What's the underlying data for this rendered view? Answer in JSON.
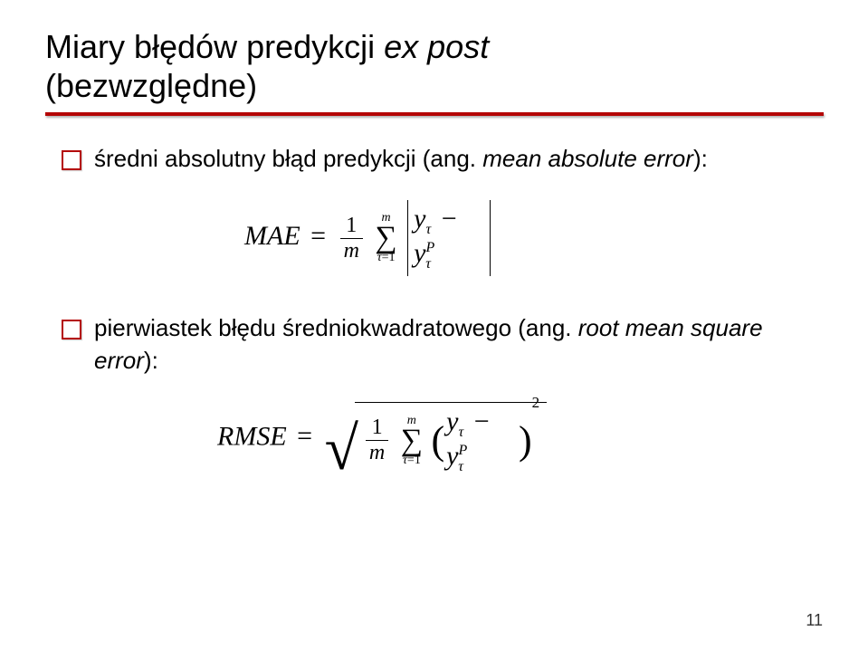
{
  "title": {
    "part1": "Miary błędów predykcji ",
    "italic": "ex post",
    "part2": "(bezwzględne)"
  },
  "bullets": [
    {
      "text1": "średni absolutny błąd predykcji (ang. ",
      "italic1": "mean absolute error",
      "text2": "):"
    },
    {
      "text1": "pierwiastek błędu średniokwadratowego (ang. ",
      "italic1": "root mean square error",
      "text2": "):"
    }
  ],
  "formulas": {
    "mae": {
      "lhs": "MAE",
      "eq": "=",
      "frac_num": "1",
      "frac_den": "m",
      "sum_top": "m",
      "sum_sigma": "∑",
      "sum_bot_var": "τ",
      "sum_bot_eq": "=",
      "sum_bot_val": "1",
      "y1": "y",
      "sub1": "τ",
      "minus": "−",
      "y2": "y",
      "sup2": "P",
      "sub2": "τ"
    },
    "rmse": {
      "lhs": "RMSE",
      "eq": "=",
      "sqrt": "√",
      "frac_num": "1",
      "frac_den": "m",
      "sum_top": "m",
      "sum_sigma": "∑",
      "sum_bot_var": "τ",
      "sum_bot_eq": "=",
      "sum_bot_val": "1",
      "lparen": "(",
      "y1": "y",
      "sub1": "τ",
      "minus": "−",
      "y2": "y",
      "sup2": "P",
      "sub2": "τ",
      "rparen": ")",
      "exp": "2"
    }
  },
  "page_number": "11"
}
